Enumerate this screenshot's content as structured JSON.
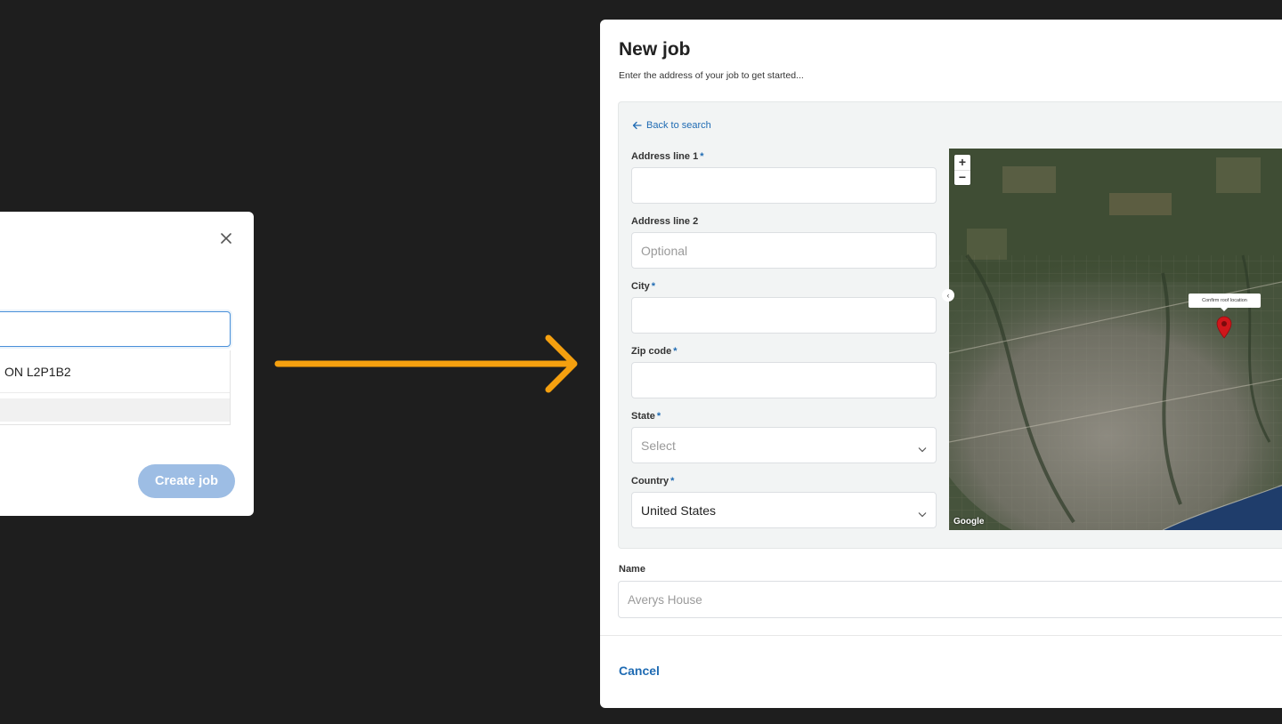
{
  "old_modal": {
    "close_icon": "close-icon",
    "address_suggestion": "ON L2P1B2",
    "create_button_label": "Create job",
    "create_button_color": "#9dbde4"
  },
  "arrow": {
    "color": "#f5a00f",
    "icon": "arrow-right-icon"
  },
  "new_job": {
    "title": "New job",
    "subtitle": "Enter the address of your job to get started...",
    "back_link": "Back to search",
    "fields": {
      "address1": {
        "label": "Address line 1",
        "required": "*",
        "value": ""
      },
      "address2": {
        "label": "Address line 2",
        "placeholder": "Optional"
      },
      "city": {
        "label": "City",
        "required": "*",
        "value": ""
      },
      "zip": {
        "label": "Zip code",
        "required": "*",
        "value": ""
      },
      "state": {
        "label": "State",
        "required": "*",
        "placeholder": "Select"
      },
      "country": {
        "label": "Country",
        "required": "*",
        "value": "United States"
      }
    },
    "map": {
      "zoom_in": "+",
      "zoom_out": "−",
      "tooltip": "Confirm roof location",
      "attribution": "Google",
      "pin_color": "#d0161b"
    },
    "name": {
      "label": "Name",
      "placeholder": "Averys House"
    },
    "cancel_label": "Cancel",
    "accent_color": "#1f6bb3"
  }
}
